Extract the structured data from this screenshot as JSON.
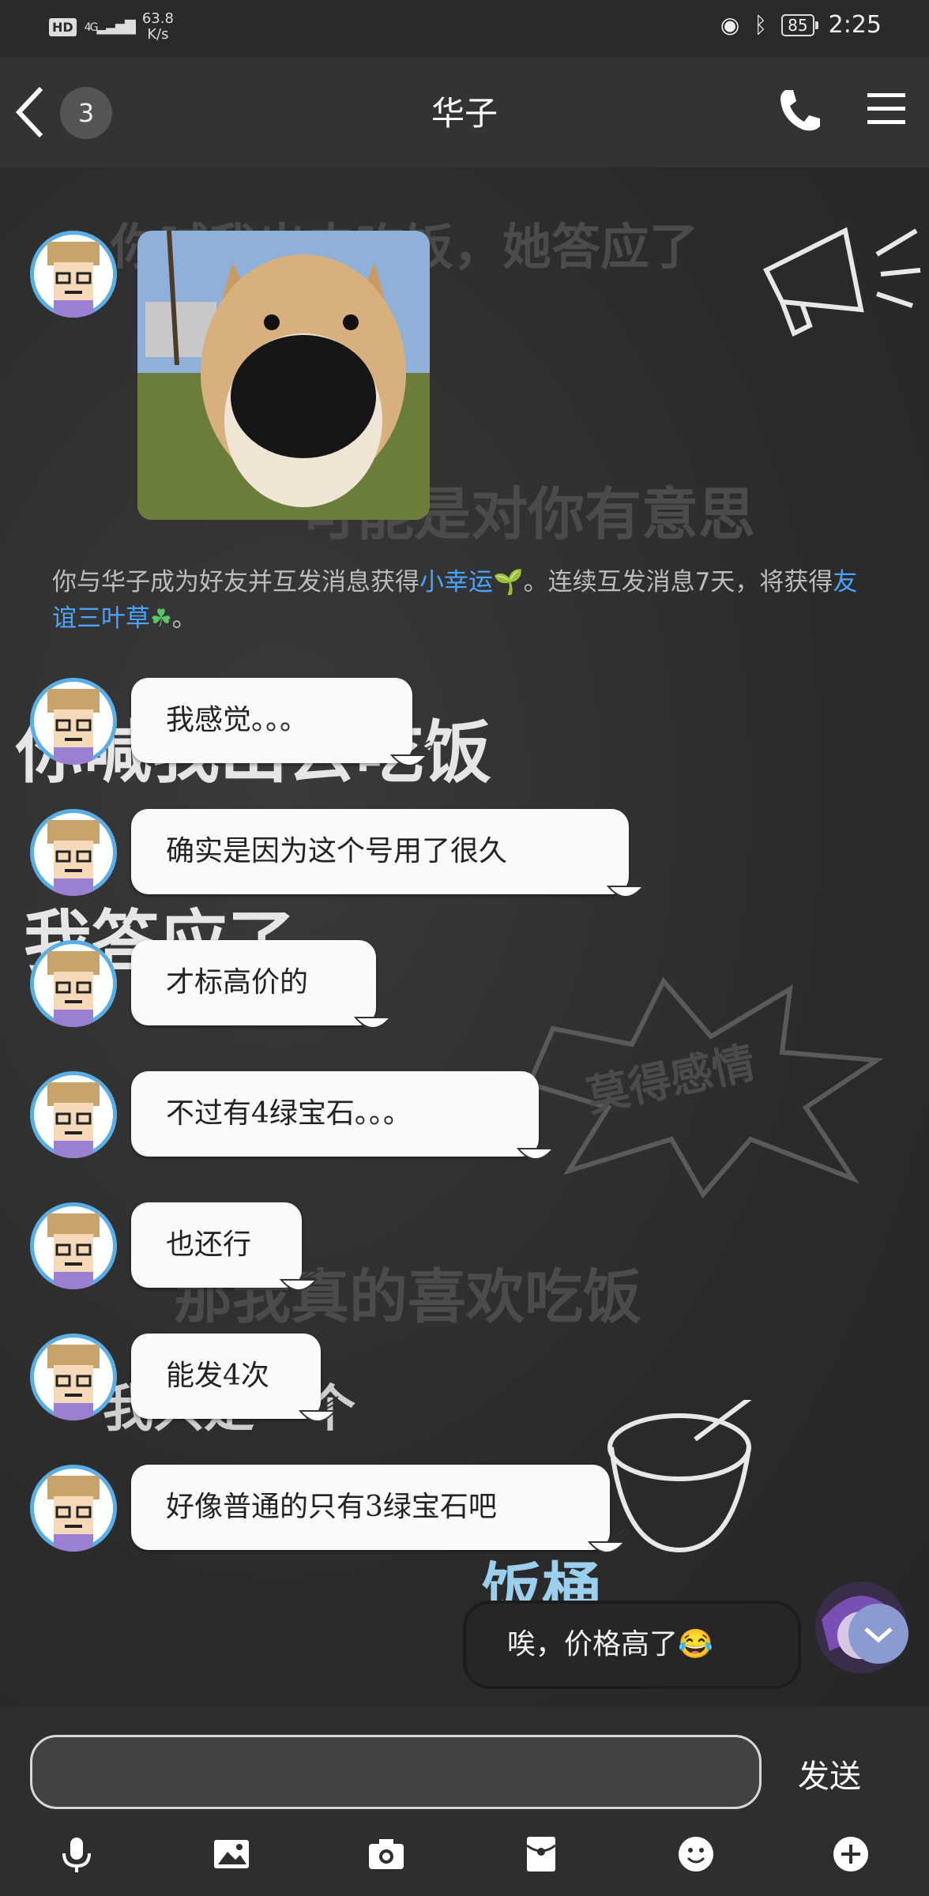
{
  "status_bar": {
    "hd": "HD",
    "network": "4G",
    "speed_value": "63.8",
    "speed_unit": "K/s",
    "battery": "85",
    "time": "2:25"
  },
  "header": {
    "unread_count": "3",
    "title": "华子"
  },
  "background_text": {
    "line1_a": "你喊我出去吃饭，她",
    "line1_b": "答应了",
    "line2": "可能是对你有意思",
    "line3_a": "你喊我出去",
    "line3_b": "吃饭",
    "line4": "我答应了",
    "burst": "莫得感情",
    "line5": "那我真的喜欢吃饭",
    "line6": "我只是一个",
    "line7": "饭桶"
  },
  "notice": {
    "part1": "你与华子成为好友并互发消息获得",
    "link1": "小幸运",
    "part2": "。连续互发消息7天，将获得",
    "link2": "友谊三叶草",
    "part3": "。"
  },
  "messages": [
    {
      "text": "我感觉。。。"
    },
    {
      "text": "确实是因为这个号用了很久"
    },
    {
      "text": "才标高价的"
    },
    {
      "text": "不过有4绿宝石。。。"
    },
    {
      "text": "也还行"
    },
    {
      "text": "能发4次"
    },
    {
      "text": "好像普通的只有3绿宝石吧"
    }
  ],
  "outgoing_message": {
    "text": "唉，价格高了",
    "emoji": "😂"
  },
  "input": {
    "value": "",
    "send_label": "发送"
  },
  "toolbar": [
    "mic-icon",
    "image-icon",
    "camera-icon",
    "red-packet-icon",
    "emoji-icon",
    "plus-icon"
  ],
  "colors": {
    "link": "#4aa3ff",
    "avatar_ring": "#5aaee8",
    "bubble": "#fafafa"
  }
}
